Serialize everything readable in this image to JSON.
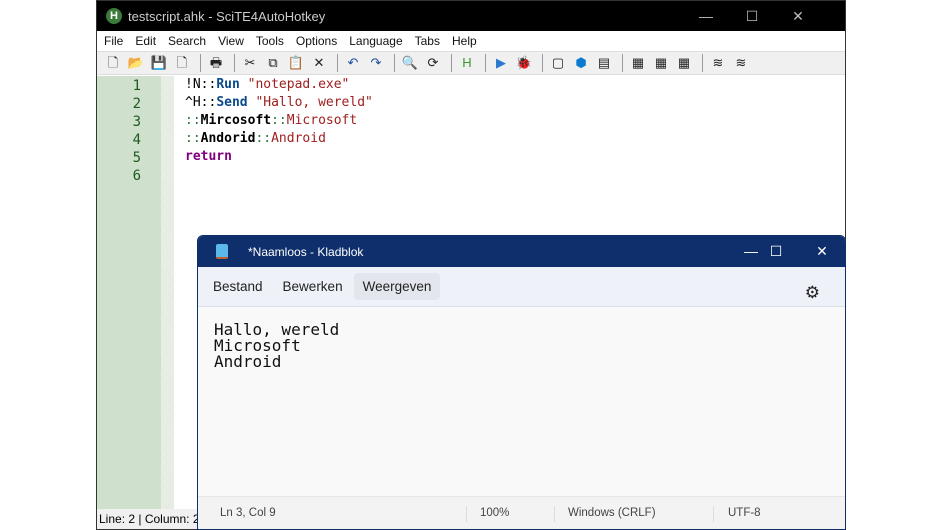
{
  "scite": {
    "title": "testscript.ahk - SciTE4AutoHotkey",
    "logo": "H",
    "menu": [
      "File",
      "Edit",
      "Search",
      "View",
      "Tools",
      "Options",
      "Language",
      "Tabs",
      "Help"
    ],
    "toolbar": [
      "new-file",
      "open",
      "save",
      "close-file",
      "print",
      "cut",
      "copy",
      "paste",
      "delete",
      "undo",
      "redo",
      "find",
      "replace",
      "autohotkey",
      "run",
      "debug",
      "inspect",
      "object",
      "window-spy",
      "toolbox1",
      "toolbox2",
      "toolbox3",
      "snippet1",
      "snippet2"
    ],
    "line_numbers": [
      "1",
      "2",
      "3",
      "4",
      "5",
      "6"
    ],
    "code": [
      [
        {
          "t": "!N::",
          "c": "op0"
        },
        {
          "t": "Run",
          "c": "kw"
        },
        {
          "t": " "
        },
        {
          "t": "\"notepad.exe\"",
          "c": "str"
        }
      ],
      [
        {
          "t": "^H::",
          "c": "op0"
        },
        {
          "t": "Send",
          "c": "kw"
        },
        {
          "t": " "
        },
        {
          "t": "\"Hallo, wereld\"",
          "c": "str"
        }
      ],
      [
        {
          "t": "::",
          "c": "op"
        },
        {
          "t": "Mircosoft",
          "c": "lbl"
        },
        {
          "t": "::",
          "c": "op"
        },
        {
          "t": "Microsoft",
          "c": "str"
        }
      ],
      [
        {
          "t": "::",
          "c": "op"
        },
        {
          "t": "Andorid",
          "c": "lbl"
        },
        {
          "t": "::",
          "c": "op"
        },
        {
          "t": "Android",
          "c": "str"
        }
      ],
      [
        {
          "t": "return",
          "c": "ret"
        }
      ]
    ],
    "status": "Line: 2 | Column: 2"
  },
  "notepad": {
    "title": "*Naamloos - Kladblok",
    "menu": [
      "Bestand",
      "Bewerken",
      "Weergeven"
    ],
    "text": "Hallo, wereld\nMicrosoft\nAndroid",
    "status": {
      "position": "Ln 3, Col 9",
      "zoom": "100%",
      "line_endings": "Windows (CRLF)",
      "encoding": "UTF-8"
    }
  }
}
